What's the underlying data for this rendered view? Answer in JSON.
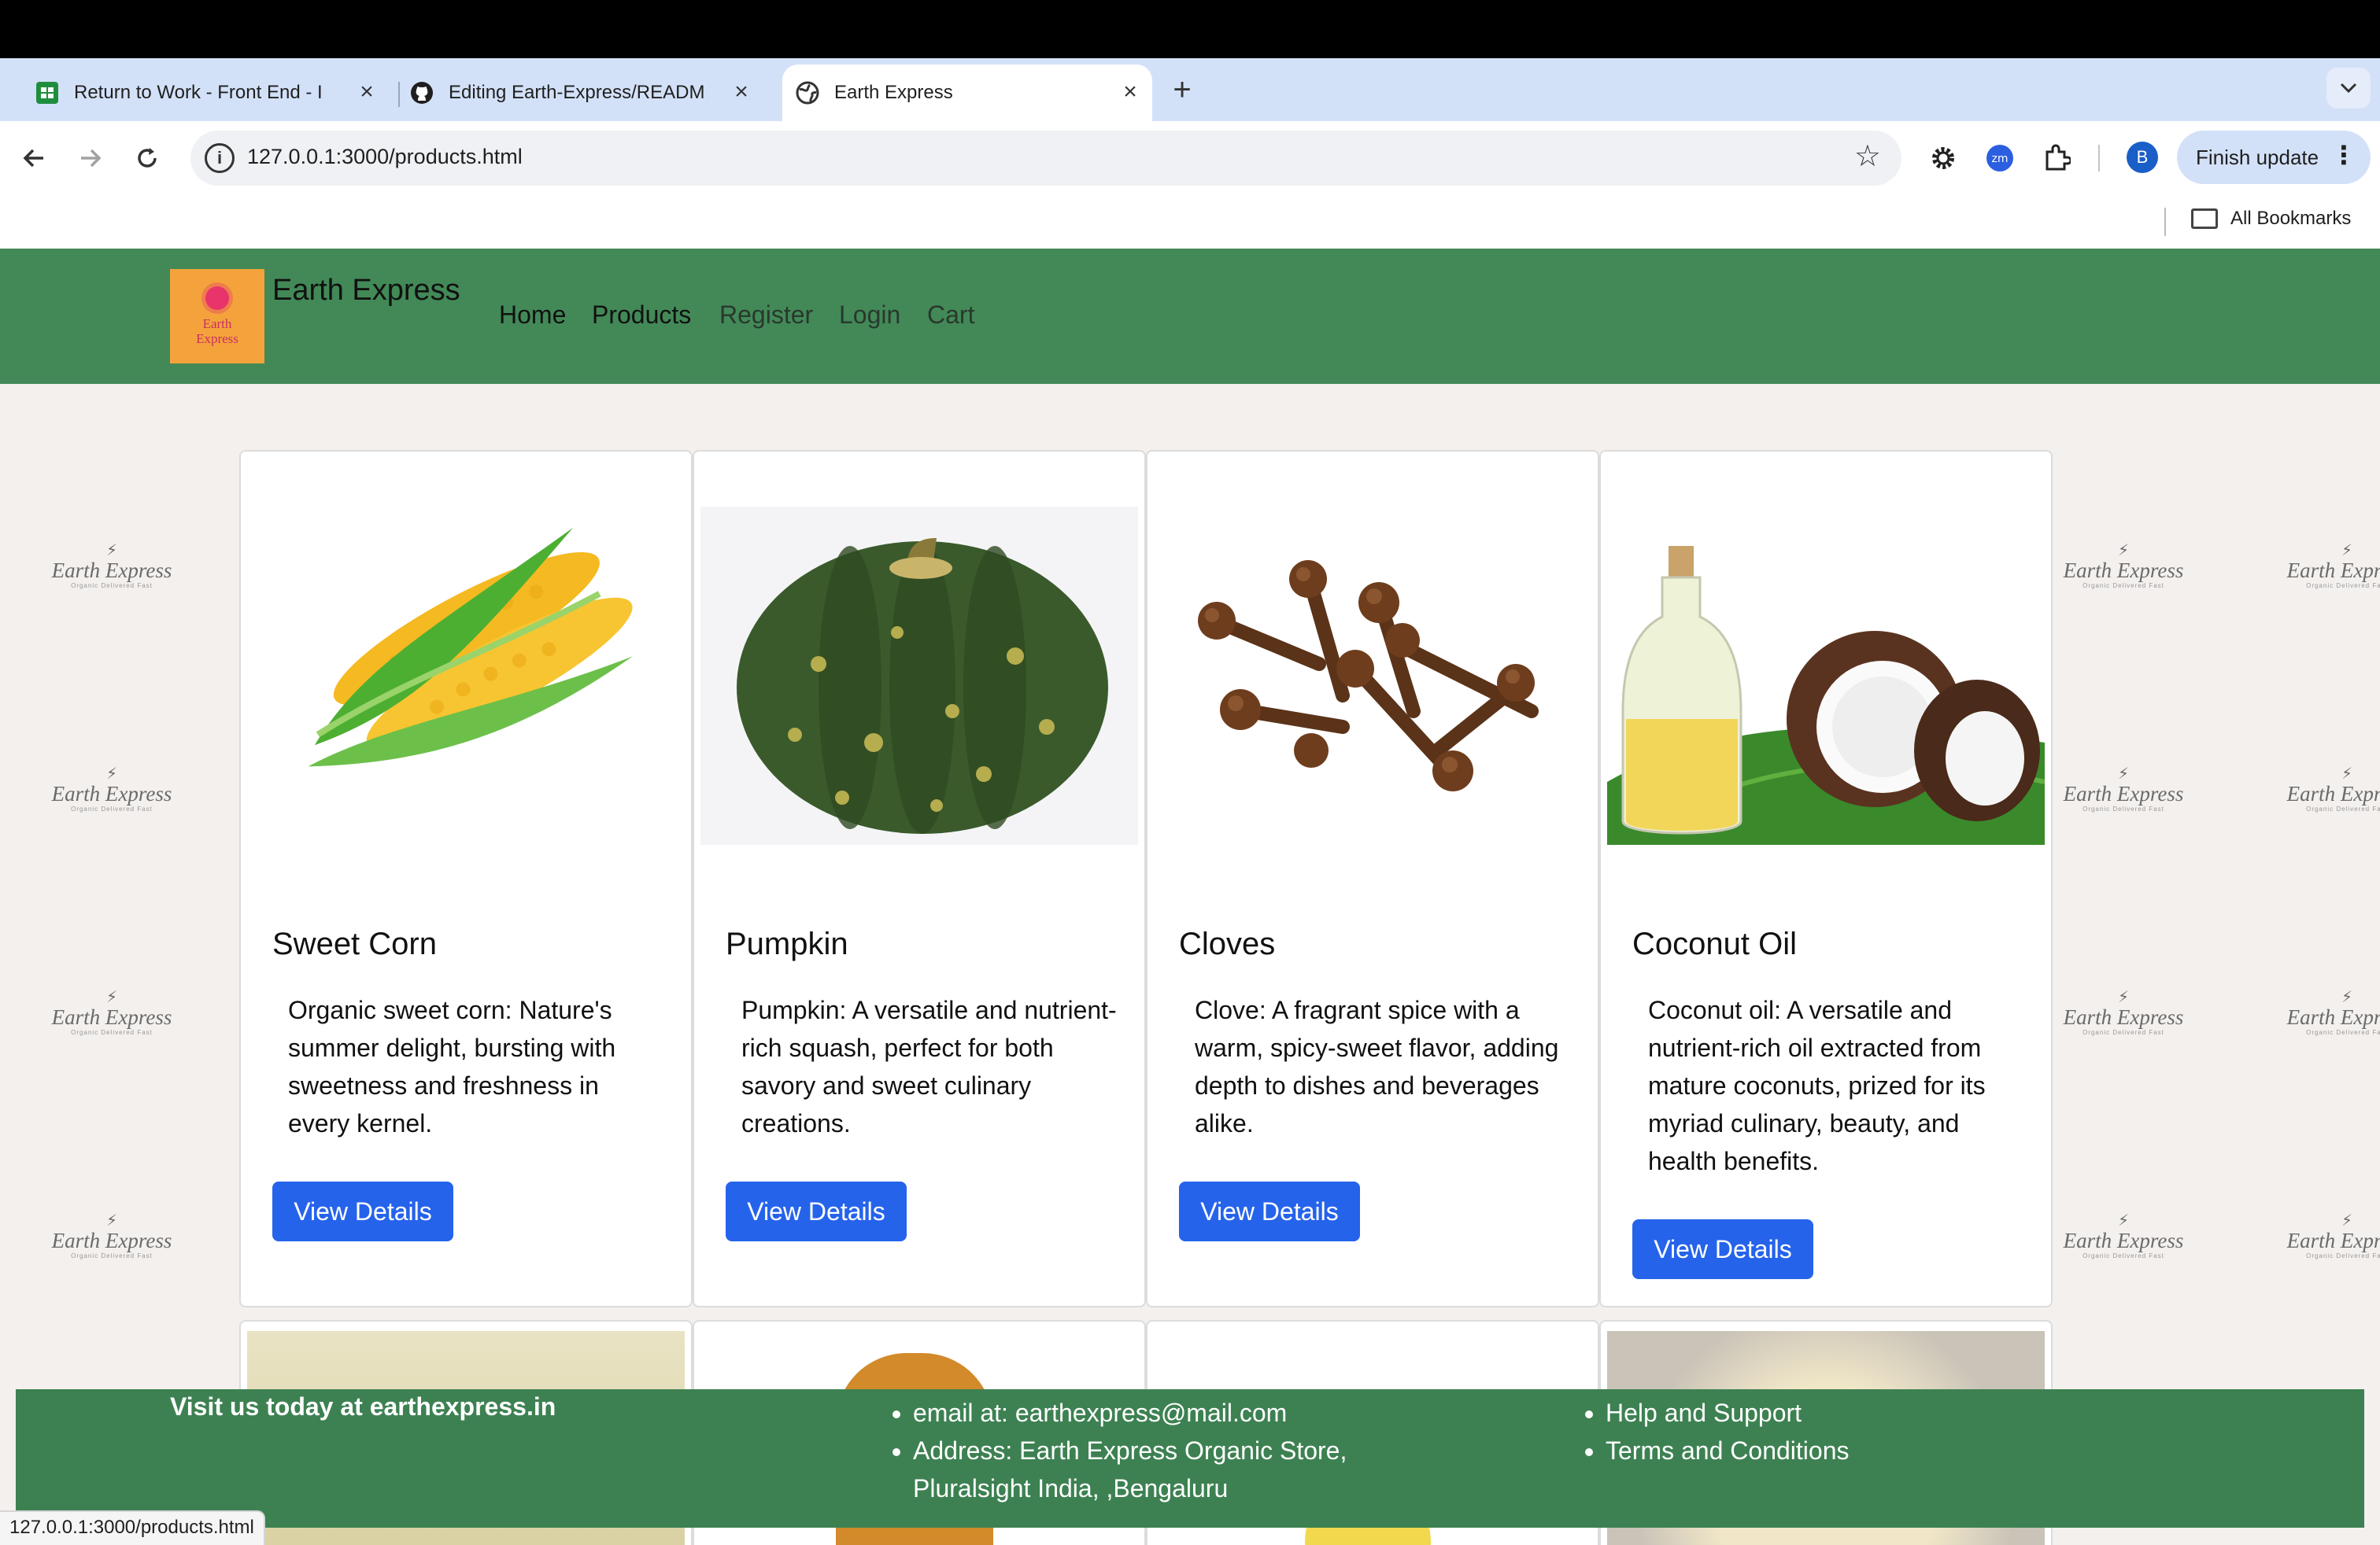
{
  "browser": {
    "tabs": [
      {
        "title": "Return to Work - Front End - I",
        "icon": "sheets-icon"
      },
      {
        "title": "Editing Earth-Express/READM",
        "icon": "github-icon"
      },
      {
        "title": "Earth Express",
        "icon": "globe-icon",
        "active": true
      }
    ],
    "url": "127.0.0.1:3000/products.html",
    "finish_update_label": "Finish update",
    "avatar_letter": "B",
    "zoom_extension_label": "zm",
    "bookmarks_label": "All Bookmarks",
    "status_url": "127.0.0.1:3000/products.html"
  },
  "site": {
    "brand": "Earth Express",
    "logo_text": "Earth Express",
    "nav": [
      "Home",
      "Products",
      "Register",
      "Login",
      "Cart"
    ],
    "watermark": {
      "title": "Earth Express",
      "tagline": "Organic Delivered Fast"
    }
  },
  "products": [
    {
      "name": "Sweet Corn",
      "description": "Organic sweet corn: Nature's summer delight, bursting with sweetness and freshness in every kernel.",
      "button": "View Details"
    },
    {
      "name": "Pumpkin",
      "description": "Pumpkin: A versatile and nutrient-rich squash, perfect for both savory and sweet culinary creations.",
      "button": "View Details"
    },
    {
      "name": "Cloves",
      "description": "Clove: A fragrant spice with a warm, spicy-sweet flavor, adding depth to dishes and beverages alike.",
      "button": "View Details"
    },
    {
      "name": "Coconut Oil",
      "description": "Coconut oil: A versatile and nutrient-rich oil extracted from mature coconuts, prized for its myriad culinary, beauty, and health benefits.",
      "button": "View Details"
    }
  ],
  "footer": {
    "visit": "Visit us today at earthexpress.in",
    "contact": [
      "email at: earthexpress@mail.com",
      "Address: Earth Express Organic Store, Pluralsight India, ,Bengaluru"
    ],
    "links": [
      "Help and Support",
      "Terms and Conditions"
    ]
  }
}
